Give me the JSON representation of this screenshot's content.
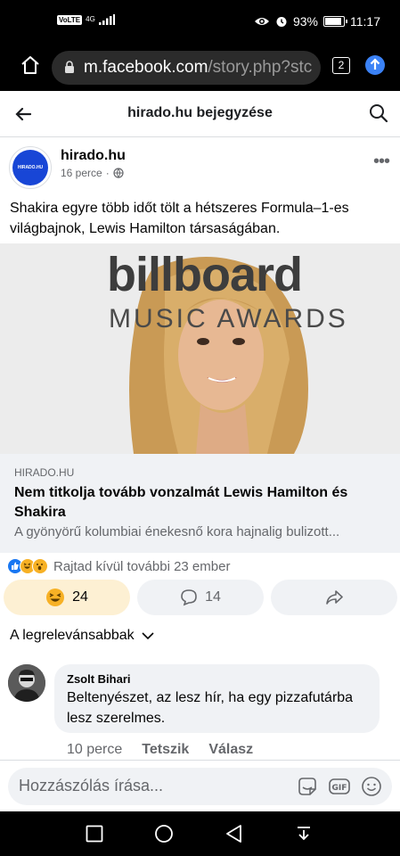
{
  "status_bar": {
    "network": "VoLTE",
    "signal_label": "4G",
    "battery_percent": "93%",
    "battery_level": 0.93,
    "time": "11:17"
  },
  "browser": {
    "url_host": "m.facebook.com",
    "url_path": "/story.php?stc",
    "tab_count": "2"
  },
  "header": {
    "title": "hirado.hu bejegyzése"
  },
  "post": {
    "page_name": "hirado.hu",
    "avatar_text": "HIRADO.HU",
    "time": "16 perce",
    "separator": "·",
    "text": "Shakira egyre több időt tölt a hétszeres Formula–1-es világbajnok, Lewis Hamilton társaságában.",
    "image_signage_top": "billboard",
    "image_signage_bottom": "MUSIC AWARDS"
  },
  "link_card": {
    "domain": "HIRADO.HU",
    "title": "Nem titkolja tovább vonzalmát Lewis Hamilton és Shakira",
    "description": "A gyönyörű kolumbiai énekesnő kora hajnalig bulizott..."
  },
  "reactions": {
    "summary": "Rajtad kívül további 23 ember",
    "icons": [
      "like",
      "haha",
      "wow"
    ]
  },
  "actions": {
    "reaction_count": "24",
    "comment_count": "14"
  },
  "sort": {
    "label": "A legrelevánsabbak"
  },
  "comment": {
    "author": "Zsolt Bihari",
    "text": "Beltenyészet, az lesz hír, ha egy pizzafutárba lesz szerelmes.",
    "time": "10 perce",
    "like_label": "Tetszik",
    "reply_label": "Válasz"
  },
  "compose": {
    "placeholder": "Hozzászólás írása..."
  },
  "colors": {
    "brand_blue": "#1877f2",
    "avatar_blue": "#1846d6",
    "active_reaction_bg": "#fdf0d3"
  }
}
